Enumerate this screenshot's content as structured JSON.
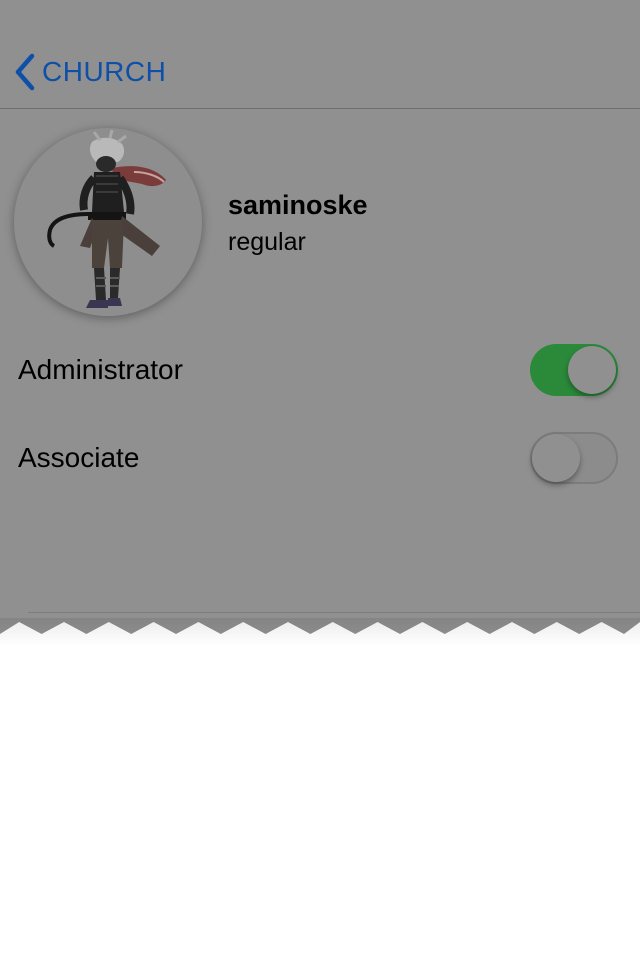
{
  "nav": {
    "back_label": "CHURCH",
    "back_icon": "chevron-left-icon",
    "accent_color": "#0e4fa8"
  },
  "profile": {
    "username": "saminoske",
    "role": "regular",
    "avatar_icon": "ninja-character-avatar"
  },
  "settings": {
    "administrator": {
      "label": "Administrator",
      "enabled": true
    },
    "associate": {
      "label": "Associate",
      "enabled": false
    }
  },
  "colors": {
    "toggle_on": "#2a8a3a",
    "overlay_dim": "#909090"
  }
}
